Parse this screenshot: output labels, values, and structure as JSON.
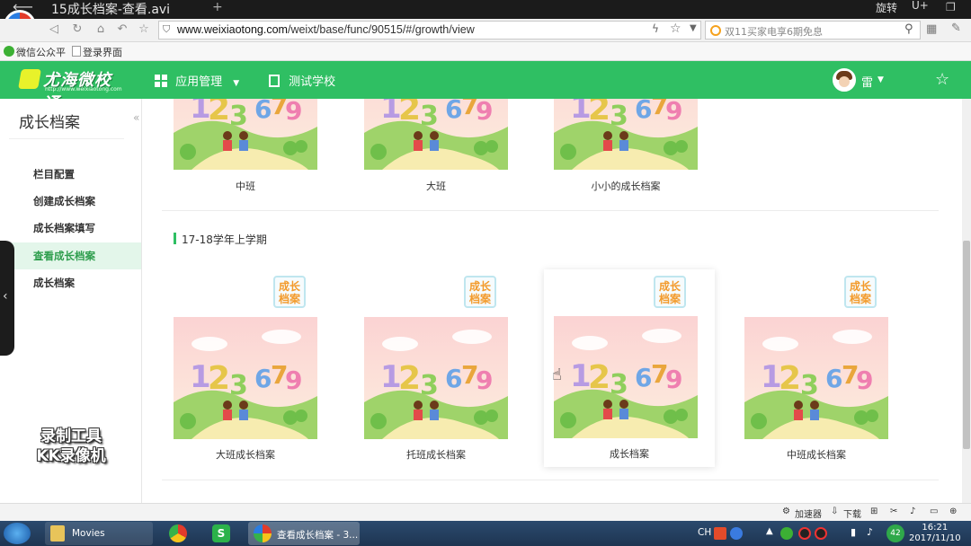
{
  "player": {
    "title": "15成长档案-查看.avi",
    "rotate_label": "旋转",
    "u_label": "U+"
  },
  "browser": {
    "url_domain": "www.weixiaotong.com",
    "url_path": "/weixt/base/func/90515/#/growth/view",
    "search_placeholder": "双11买家电享6期免息",
    "bookmarks": [
      "微信公众平",
      "登录界面"
    ]
  },
  "header": {
    "logo_name": "尤海微校通",
    "logo_sub": "http://www.weixiaotong.com",
    "menu_apps": "应用管理",
    "menu_school": "测试学校",
    "user_name": "雷"
  },
  "sidebar": {
    "title": "成长档案",
    "items": [
      {
        "label": "栏目配置",
        "active": false
      },
      {
        "label": "创建成长档案",
        "active": false
      },
      {
        "label": "成长档案填写",
        "active": false
      },
      {
        "label": "查看成长档案",
        "active": true
      },
      {
        "label": "成长档案",
        "active": false
      }
    ]
  },
  "main": {
    "top_cards": [
      "中班",
      "大班",
      "小小的成长档案"
    ],
    "section_title": "17-18学年上学期",
    "badge_text": "成长档案",
    "badge_line1": "成长",
    "badge_line2": "档案",
    "section_cards": [
      "大班成长档案",
      "托班成长档案",
      "成长档案",
      "中班成长档案"
    ]
  },
  "status_strip": {
    "accelerator": "加速器",
    "download": "下载"
  },
  "taskbar": {
    "items": [
      "Movies",
      "查看成长档案 - 3..."
    ],
    "ime": "CH",
    "battery": "42",
    "time": "16:21",
    "date": "2017/11/10"
  },
  "watermark": {
    "line1": "录制工具",
    "line2": "KK录像机"
  },
  "colors": {
    "brand_green": "#2fbf63",
    "active_bg": "#e3f6ea",
    "badge_orange": "#f39a2a"
  }
}
